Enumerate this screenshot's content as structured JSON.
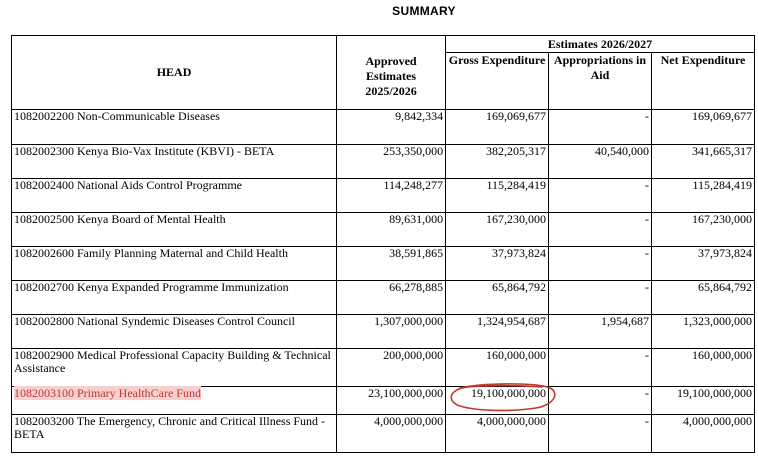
{
  "title": "SUMMARY",
  "table": {
    "headers": {
      "head": "HEAD",
      "approved": "Approved Estimates 2025/2026",
      "estimates_group": "Estimates 2026/2027",
      "gross": "Gross Expenditure",
      "aia": "Appropriations in Aid",
      "net": "Net Expenditure"
    },
    "rows": [
      {
        "name": "1082002200 Non-Communicable Diseases",
        "approved": "9,842,334",
        "gross": "169,069,677",
        "aia": "-",
        "net": "169,069,677"
      },
      {
        "name": "1082002300 Kenya Bio-Vax Institute (KBVI) - BETA",
        "approved": "253,350,000",
        "gross": "382,205,317",
        "aia": "40,540,000",
        "net": "341,665,317"
      },
      {
        "name": "1082002400 National Aids Control Programme",
        "approved": "114,248,277",
        "gross": "115,284,419",
        "aia": "-",
        "net": "115,284,419"
      },
      {
        "name": "1082002500 Kenya Board of Mental Health",
        "approved": "89,631,000",
        "gross": "167,230,000",
        "aia": "-",
        "net": "167,230,000"
      },
      {
        "name": "1082002600 Family Planning Maternal and Child Health",
        "approved": "38,591,865",
        "gross": "37,973,824",
        "aia": "-",
        "net": "37,973,824"
      },
      {
        "name": "1082002700 Kenya Expanded Programme Immunization",
        "approved": "66,278,885",
        "gross": "65,864,792",
        "aia": "-",
        "net": "65,864,792"
      },
      {
        "name": "1082002800 National Syndemic Diseases Control Council",
        "approved": "1,307,000,000",
        "gross": "1,324,954,687",
        "aia": "1,954,687",
        "net": "1,323,000,000"
      },
      {
        "name": "1082002900 Medical Professional Capacity Building & Technical Assistance",
        "approved": "200,000,000",
        "gross": "160,000,000",
        "aia": "-",
        "net": "160,000,000"
      },
      {
        "name": "1082003100 Primary HealthCare Fund",
        "approved": "23,100,000,000",
        "gross": "19,100,000,000",
        "aia": "-",
        "net": "19,100,000,000"
      },
      {
        "name": "1082003200 The Emergency, Chronic and Critical Illness Fund - BETA",
        "approved": "4,000,000,000",
        "gross": "4,000,000,000",
        "aia": "-",
        "net": "4,000,000,000"
      }
    ]
  },
  "annotations": {
    "highlight_color": "#f6d0d0",
    "circle_color": "#c0392b"
  }
}
